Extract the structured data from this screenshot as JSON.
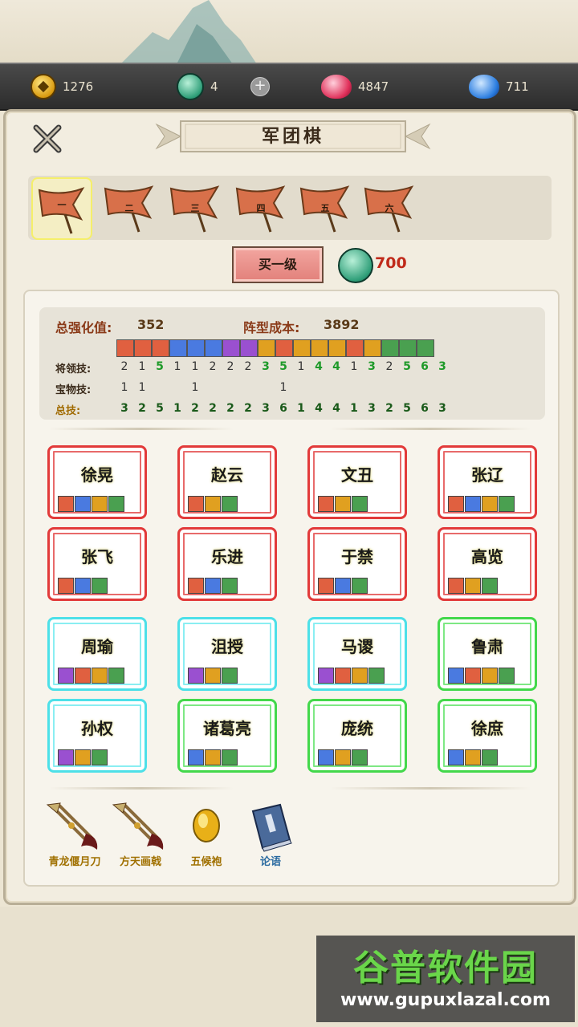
{
  "resources": [
    {
      "icon": "coin-icon",
      "value": "1276"
    },
    {
      "icon": "jade-dragon-icon",
      "value": "4"
    },
    {
      "icon": "red-flame-icon",
      "value": "4847"
    },
    {
      "icon": "blue-flame-icon",
      "value": "711"
    }
  ],
  "panel": {
    "title": "军团棋"
  },
  "flags": [
    {
      "label": "一",
      "selected": true
    },
    {
      "label": "二",
      "selected": false
    },
    {
      "label": "三",
      "selected": false
    },
    {
      "label": "四",
      "selected": false
    },
    {
      "label": "五",
      "selected": false
    },
    {
      "label": "六",
      "selected": false
    }
  ],
  "buy": {
    "label": "买一级",
    "cost": "700"
  },
  "stats": {
    "total_label": "总强化值:",
    "total_value": "352",
    "formation_label": "阵型成本:",
    "formation_value": "3892"
  },
  "skill_colors": [
    "#e06040",
    "#e06040",
    "#e06040",
    "#4a7ae0",
    "#4a7ae0",
    "#4a7ae0",
    "#9a50d0",
    "#9a50d0",
    "#e0a020",
    "#e06040",
    "#e0a020",
    "#e0a020",
    "#e0a020",
    "#e06040",
    "#e0a020",
    "#4aa050",
    "#4aa050",
    "#4aa050"
  ],
  "rows": [
    {
      "label": "将领技:",
      "values": [
        "2",
        "1",
        "5",
        "1",
        "1",
        "2",
        "2",
        "2",
        "3",
        "5",
        "1",
        "4",
        "4",
        "1",
        "3",
        "2",
        "5",
        "6",
        "3"
      ]
    },
    {
      "label": "宝物技:",
      "values": [
        "1",
        "1",
        "",
        "",
        "1",
        "",
        "",
        "",
        "",
        "1",
        "",
        "",
        "",
        "",
        "",
        "",
        "",
        "",
        ""
      ]
    },
    {
      "label": "总技:",
      "values": [
        "3",
        "2",
        "5",
        "1",
        "2",
        "2",
        "2",
        "2",
        "3",
        "6",
        "1",
        "4",
        "4",
        "1",
        "3",
        "2",
        "5",
        "6",
        "3"
      ]
    }
  ],
  "generals": [
    {
      "name": "徐晃",
      "border": "red",
      "chips": [
        "#e06040",
        "#4a7ae0",
        "#e0a020",
        "#4aa050"
      ]
    },
    {
      "name": "赵云",
      "border": "red",
      "chips": [
        "#e06040",
        "#e0a020",
        "#4aa050"
      ]
    },
    {
      "name": "文丑",
      "border": "red",
      "chips": [
        "#e06040",
        "#e0a020",
        "#4aa050"
      ]
    },
    {
      "name": "张辽",
      "border": "red",
      "chips": [
        "#e06040",
        "#4a7ae0",
        "#e0a020",
        "#4aa050"
      ]
    },
    {
      "name": "张飞",
      "border": "red",
      "chips": [
        "#e06040",
        "#4a7ae0",
        "#4aa050"
      ]
    },
    {
      "name": "乐进",
      "border": "red",
      "chips": [
        "#e06040",
        "#4a7ae0",
        "#4aa050"
      ]
    },
    {
      "name": "于禁",
      "border": "red",
      "chips": [
        "#e06040",
        "#4a7ae0",
        "#4aa050"
      ]
    },
    {
      "name": "高览",
      "border": "red",
      "chips": [
        "#e06040",
        "#e0a020",
        "#4aa050"
      ]
    },
    {
      "name": "周瑜",
      "border": "cyan",
      "chips": [
        "#9a50d0",
        "#e06040",
        "#e0a020",
        "#4aa050"
      ]
    },
    {
      "name": "沮授",
      "border": "cyan",
      "chips": [
        "#9a50d0",
        "#e0a020",
        "#4aa050"
      ]
    },
    {
      "name": "马谡",
      "border": "cyan",
      "chips": [
        "#9a50d0",
        "#e06040",
        "#e0a020",
        "#4aa050"
      ]
    },
    {
      "name": "鲁肃",
      "border": "green",
      "chips": [
        "#4a7ae0",
        "#e06040",
        "#e0a020",
        "#4aa050"
      ]
    },
    {
      "name": "孙权",
      "border": "cyan",
      "chips": [
        "#9a50d0",
        "#e0a020",
        "#4aa050"
      ]
    },
    {
      "name": "诸葛亮",
      "border": "green",
      "chips": [
        "#4a7ae0",
        "#e0a020",
        "#4aa050"
      ]
    },
    {
      "name": "庞统",
      "border": "green",
      "chips": [
        "#4a7ae0",
        "#e0a020",
        "#4aa050"
      ]
    },
    {
      "name": "徐庶",
      "border": "green",
      "chips": [
        "#4a7ae0",
        "#e0a020",
        "#4aa050"
      ]
    }
  ],
  "items": [
    {
      "label": "青龙偃月刀",
      "icon": "crossed-blades-icon"
    },
    {
      "label": "方天画戟",
      "icon": "halberd-icon"
    },
    {
      "label": "五候袍",
      "icon": "golden-orb-icon"
    },
    {
      "label": "论语",
      "icon": "book-icon"
    }
  ],
  "watermark": {
    "title": "谷普软件园",
    "url": "www.gupuxlazal.com"
  }
}
